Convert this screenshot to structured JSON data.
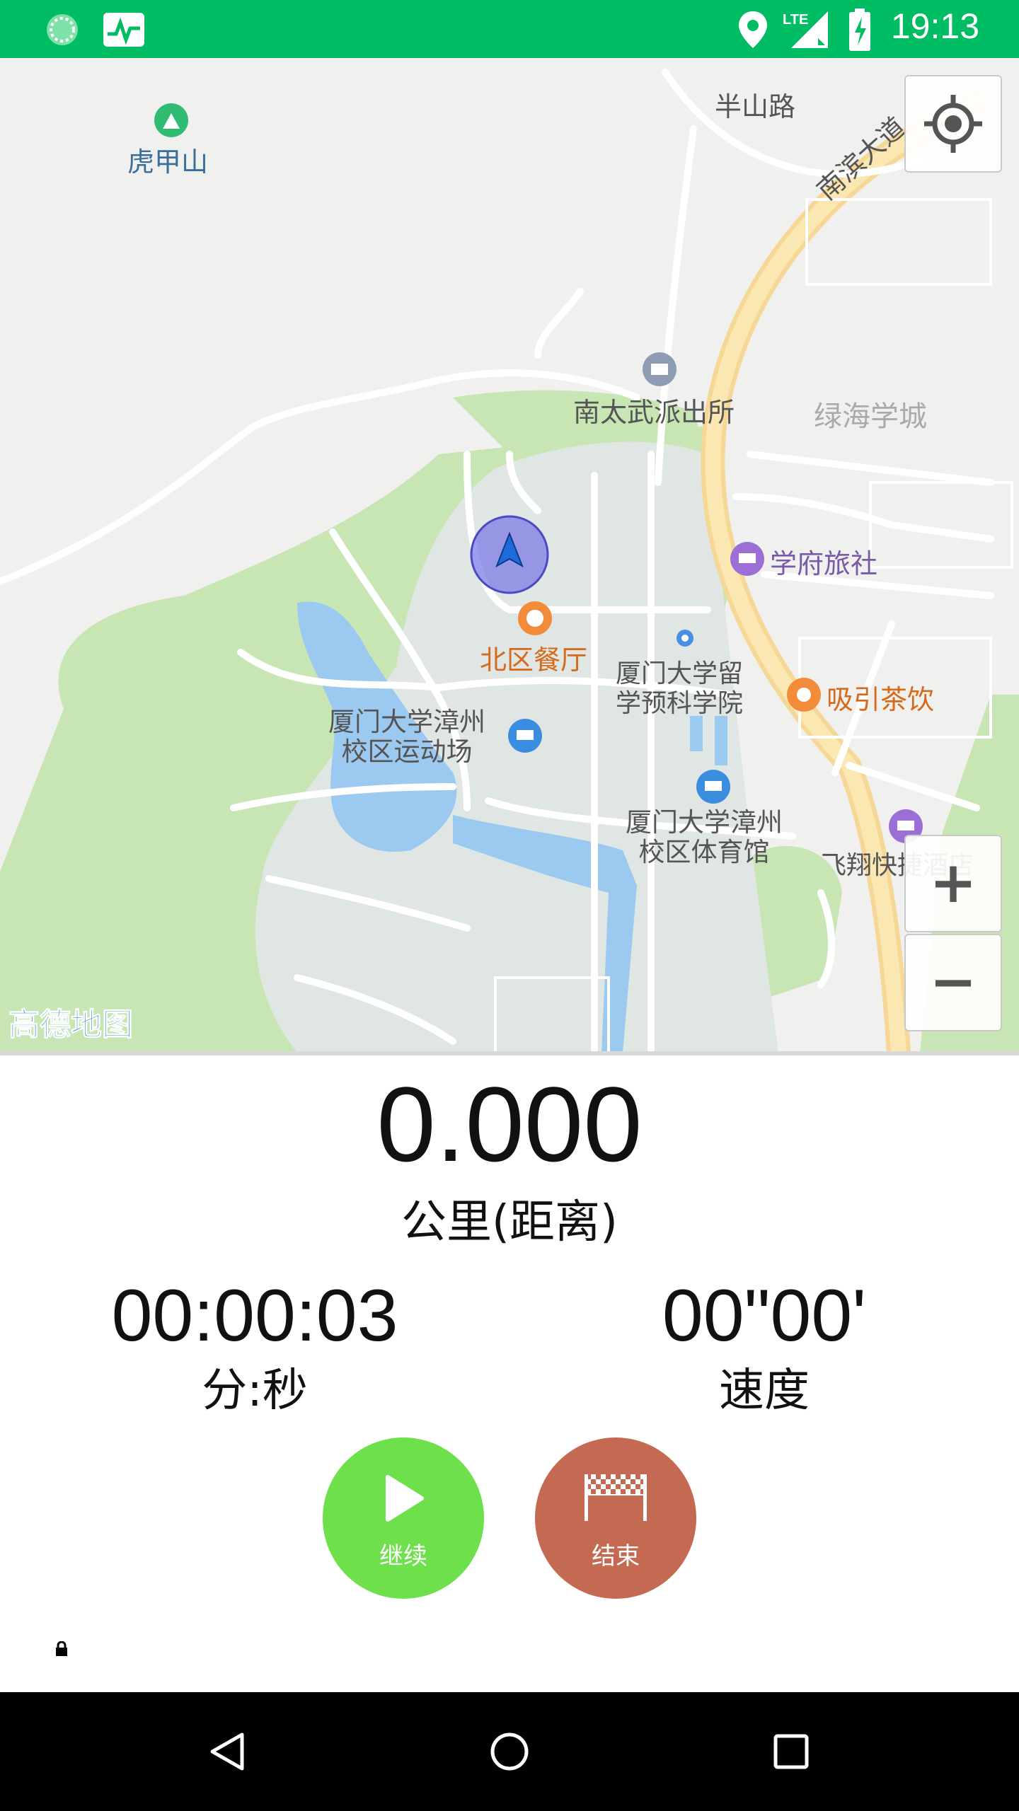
{
  "status_bar": {
    "time": "19:13",
    "network": "LTE"
  },
  "map": {
    "attribution": "高德地图",
    "labels": {
      "hujiashan": "虎甲山",
      "banshanlu": "半山路",
      "nanbin": "南滨大道",
      "police": "南太武派出所",
      "lvhai": "绿海学城",
      "xuefu": "学府旅社",
      "beiqu": "北区餐厅",
      "prep1": "厦门大学留",
      "prep2": "学预科学院",
      "tea": "吸引茶饮",
      "stadium1": "厦门大学漳州",
      "stadium2": "校区运动场",
      "gym1": "厦门大学漳州",
      "gym2": "校区体育馆",
      "hotel": "飞翔快捷酒店"
    },
    "controls": {
      "zoom_in": "+",
      "zoom_out": "−"
    }
  },
  "stats": {
    "distance_value": "0.000",
    "distance_label": "公里(距离)",
    "time_value": "00:00:03",
    "time_label": "分:秒",
    "speed_value": "00\"00'",
    "speed_label": "速度"
  },
  "actions": {
    "continue_label": "继续",
    "finish_label": "结束"
  },
  "colors": {
    "status_bar": "#00bd64",
    "continue": "#6ee04c",
    "finish": "#c46a52"
  }
}
